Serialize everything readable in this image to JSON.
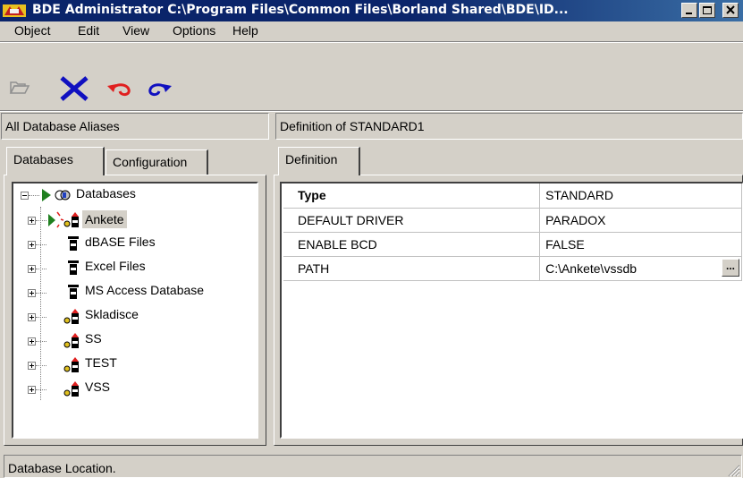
{
  "window": {
    "title": "BDE Administrator  C:\\Program Files\\Common Files\\Borland Shared\\BDE\\ID...",
    "controls": [
      "minimize-icon",
      "maximize-icon",
      "close-icon"
    ]
  },
  "menu": {
    "items": [
      {
        "label": "Object"
      },
      {
        "label": "Edit"
      },
      {
        "label": "View"
      },
      {
        "label": "Options"
      },
      {
        "label": "Help"
      }
    ]
  },
  "toolbar": {
    "icons": [
      "open-icon",
      "delete-icon",
      "undo-icon",
      "redo-icon"
    ],
    "colors": {
      "delete": "#1010c0",
      "undo": "#e02020",
      "redo": "#1010c0"
    }
  },
  "left_pane": {
    "header": "All Database Aliases",
    "tabs": [
      {
        "label": "Databases"
      },
      {
        "label": "Configuration"
      }
    ],
    "tree": {
      "root": "Databases",
      "items": [
        {
          "label": "Ankete",
          "selected": true
        },
        {
          "label": "dBASE Files"
        },
        {
          "label": "Excel Files"
        },
        {
          "label": "MS Access Database"
        },
        {
          "label": "Skladisce"
        },
        {
          "label": "SS"
        },
        {
          "label": "TEST"
        },
        {
          "label": "VSS"
        }
      ]
    }
  },
  "right_pane": {
    "header": "Definition of STANDARD1",
    "tab": "Definition",
    "rows": [
      {
        "name": "Type",
        "value": "STANDARD"
      },
      {
        "name": "DEFAULT DRIVER",
        "value": "PARADOX"
      },
      {
        "name": "ENABLE BCD",
        "value": "FALSE"
      },
      {
        "name": "PATH",
        "value": "C:\\Ankete\\vssdb"
      }
    ],
    "ellipsis_label": "..."
  },
  "status": {
    "text": "Database Location."
  }
}
